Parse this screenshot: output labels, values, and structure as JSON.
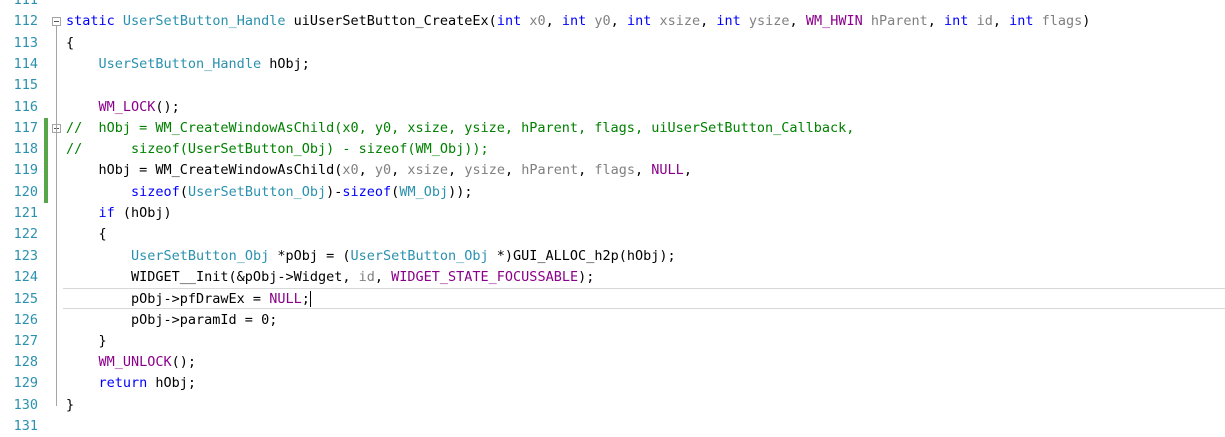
{
  "editor": {
    "lines": [
      {
        "num": "111",
        "tokens": []
      },
      {
        "num": "112",
        "fold": true,
        "tokens": [
          {
            "t": "kw",
            "v": "static"
          },
          {
            "t": "pl",
            "v": " "
          },
          {
            "t": "ty",
            "v": "UserSetButton_Handle"
          },
          {
            "t": "pl",
            "v": " uiUserSetButton_CreateEx("
          },
          {
            "t": "kw",
            "v": "int"
          },
          {
            "t": "pl",
            "v": " "
          },
          {
            "t": "pm",
            "v": "x0"
          },
          {
            "t": "pl",
            "v": ", "
          },
          {
            "t": "kw",
            "v": "int"
          },
          {
            "t": "pl",
            "v": " "
          },
          {
            "t": "pm",
            "v": "y0"
          },
          {
            "t": "pl",
            "v": ", "
          },
          {
            "t": "kw",
            "v": "int"
          },
          {
            "t": "pl",
            "v": " "
          },
          {
            "t": "pm",
            "v": "xsize"
          },
          {
            "t": "pl",
            "v": ", "
          },
          {
            "t": "kw",
            "v": "int"
          },
          {
            "t": "pl",
            "v": " "
          },
          {
            "t": "pm",
            "v": "ysize"
          },
          {
            "t": "pl",
            "v": ", "
          },
          {
            "t": "pp",
            "v": "WM_HWIN"
          },
          {
            "t": "pl",
            "v": " "
          },
          {
            "t": "pm",
            "v": "hParent"
          },
          {
            "t": "pl",
            "v": ", "
          },
          {
            "t": "kw",
            "v": "int"
          },
          {
            "t": "pl",
            "v": " "
          },
          {
            "t": "pm",
            "v": "id"
          },
          {
            "t": "pl",
            "v": ", "
          },
          {
            "t": "kw",
            "v": "int"
          },
          {
            "t": "pl",
            "v": " "
          },
          {
            "t": "pm",
            "v": "flags"
          },
          {
            "t": "pl",
            "v": ")"
          }
        ]
      },
      {
        "num": "113",
        "tokens": [
          {
            "t": "pl",
            "v": "{"
          }
        ]
      },
      {
        "num": "114",
        "tokens": [
          {
            "t": "pl",
            "v": "    "
          },
          {
            "t": "ty",
            "v": "UserSetButton_Handle"
          },
          {
            "t": "pl",
            "v": " hObj;"
          }
        ]
      },
      {
        "num": "115",
        "tokens": []
      },
      {
        "num": "116",
        "tokens": [
          {
            "t": "pl",
            "v": "    "
          },
          {
            "t": "pp",
            "v": "WM_LOCK"
          },
          {
            "t": "pl",
            "v": "();"
          }
        ]
      },
      {
        "num": "117",
        "fold": true,
        "changed": true,
        "tokens": [
          {
            "t": "cm",
            "v": "//  hObj = WM_CreateWindowAsChild(x0, y0, xsize, ysize, hParent, flags, uiUserSetButton_Callback,"
          }
        ]
      },
      {
        "num": "118",
        "changed": true,
        "tokens": [
          {
            "t": "cm",
            "v": "//      sizeof(UserSetButton_Obj) - sizeof(WM_Obj));"
          }
        ]
      },
      {
        "num": "119",
        "changed": true,
        "tokens": [
          {
            "t": "pl",
            "v": "    hObj = WM_CreateWindowAsChild("
          },
          {
            "t": "pm",
            "v": "x0"
          },
          {
            "t": "pl",
            "v": ", "
          },
          {
            "t": "pm",
            "v": "y0"
          },
          {
            "t": "pl",
            "v": ", "
          },
          {
            "t": "pm",
            "v": "xsize"
          },
          {
            "t": "pl",
            "v": ", "
          },
          {
            "t": "pm",
            "v": "ysize"
          },
          {
            "t": "pl",
            "v": ", "
          },
          {
            "t": "pm",
            "v": "hParent"
          },
          {
            "t": "pl",
            "v": ", "
          },
          {
            "t": "pm",
            "v": "flags"
          },
          {
            "t": "pl",
            "v": ", "
          },
          {
            "t": "pp",
            "v": "NULL"
          },
          {
            "t": "pl",
            "v": ","
          }
        ]
      },
      {
        "num": "120",
        "changed": true,
        "tokens": [
          {
            "t": "pl",
            "v": "        "
          },
          {
            "t": "kw",
            "v": "sizeof"
          },
          {
            "t": "pl",
            "v": "("
          },
          {
            "t": "ty",
            "v": "UserSetButton_Obj"
          },
          {
            "t": "pl",
            "v": ")-"
          },
          {
            "t": "kw",
            "v": "sizeof"
          },
          {
            "t": "pl",
            "v": "("
          },
          {
            "t": "ty",
            "v": "WM_Obj"
          },
          {
            "t": "pl",
            "v": "));"
          }
        ]
      },
      {
        "num": "121",
        "tokens": [
          {
            "t": "pl",
            "v": "    "
          },
          {
            "t": "kw",
            "v": "if"
          },
          {
            "t": "pl",
            "v": " (hObj)"
          }
        ]
      },
      {
        "num": "122",
        "tokens": [
          {
            "t": "pl",
            "v": "    {"
          }
        ]
      },
      {
        "num": "123",
        "tokens": [
          {
            "t": "pl",
            "v": "        "
          },
          {
            "t": "ty",
            "v": "UserSetButton_Obj"
          },
          {
            "t": "pl",
            "v": " *pObj = ("
          },
          {
            "t": "ty",
            "v": "UserSetButton_Obj"
          },
          {
            "t": "pl",
            "v": " *)GUI_ALLOC_h2p(hObj);"
          }
        ]
      },
      {
        "num": "124",
        "tokens": [
          {
            "t": "pl",
            "v": "        WIDGET__Init(&pObj->Widget, "
          },
          {
            "t": "pm",
            "v": "id"
          },
          {
            "t": "pl",
            "v": ", "
          },
          {
            "t": "pp",
            "v": "WIDGET_STATE_FOCUSSABLE"
          },
          {
            "t": "pl",
            "v": ");"
          }
        ]
      },
      {
        "num": "125",
        "current": true,
        "tokens": [
          {
            "t": "pl",
            "v": "        pObj->pfDrawEx = "
          },
          {
            "t": "pp",
            "v": "NULL"
          },
          {
            "t": "pl",
            "v": ";"
          }
        ]
      },
      {
        "num": "126",
        "tokens": [
          {
            "t": "pl",
            "v": "        pObj->paramId = 0;"
          }
        ]
      },
      {
        "num": "127",
        "tokens": [
          {
            "t": "pl",
            "v": "    }"
          }
        ]
      },
      {
        "num": "128",
        "tokens": [
          {
            "t": "pl",
            "v": "    "
          },
          {
            "t": "pp",
            "v": "WM_UNLOCK"
          },
          {
            "t": "pl",
            "v": "();"
          }
        ]
      },
      {
        "num": "129",
        "tokens": [
          {
            "t": "pl",
            "v": "    "
          },
          {
            "t": "kw",
            "v": "return"
          },
          {
            "t": "pl",
            "v": " hObj;"
          }
        ]
      },
      {
        "num": "130",
        "tokens": [
          {
            "t": "pl",
            "v": "}"
          }
        ]
      },
      {
        "num": "131",
        "tokens": []
      }
    ]
  },
  "colors": {
    "keyword": "#0000ff",
    "type": "#2b91af",
    "macro": "#8b008b",
    "parameter": "#808080",
    "comment": "#008000",
    "line_number": "#2b91af",
    "change_bar": "#57a64a"
  },
  "icons": {
    "fold": "collapse-minus-icon"
  }
}
